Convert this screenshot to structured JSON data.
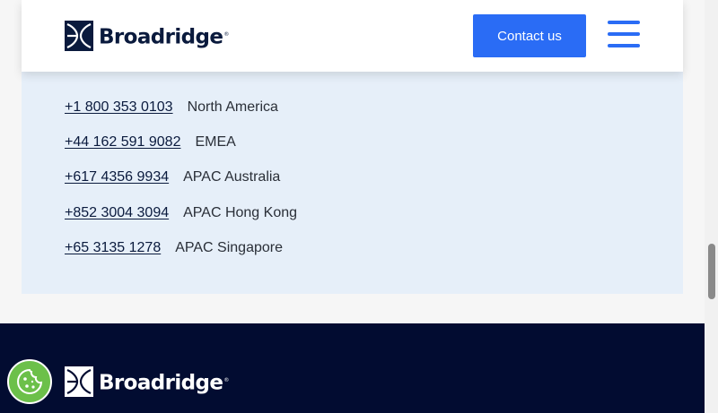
{
  "header": {
    "logo_text": "Broadridge",
    "logo_mark": "®",
    "contact_label": "Contact us",
    "menu_icon": "hamburger-menu-icon"
  },
  "phones": [
    {
      "number": "+1 800 353 0103",
      "region": "North America"
    },
    {
      "number": "+44 162 591 9082",
      "region": "EMEA"
    },
    {
      "number": "+617 4356 9934",
      "region": "APAC Australia"
    },
    {
      "number": "+852 3004 3094",
      "region": "APAC Hong Kong"
    },
    {
      "number": "+65 3135 1278",
      "region": "APAC Singapore"
    }
  ],
  "footer": {
    "logo_text": "Broadridge",
    "logo_mark": "®"
  },
  "cookie": {
    "icon": "cookie-icon"
  },
  "colors": {
    "brand_navy": "#0a1a3d",
    "accent_blue": "#2a6cf5",
    "panel_bg": "#e6eff9",
    "footer_bg": "#020c31",
    "cookie_green": "#6cc04a"
  }
}
